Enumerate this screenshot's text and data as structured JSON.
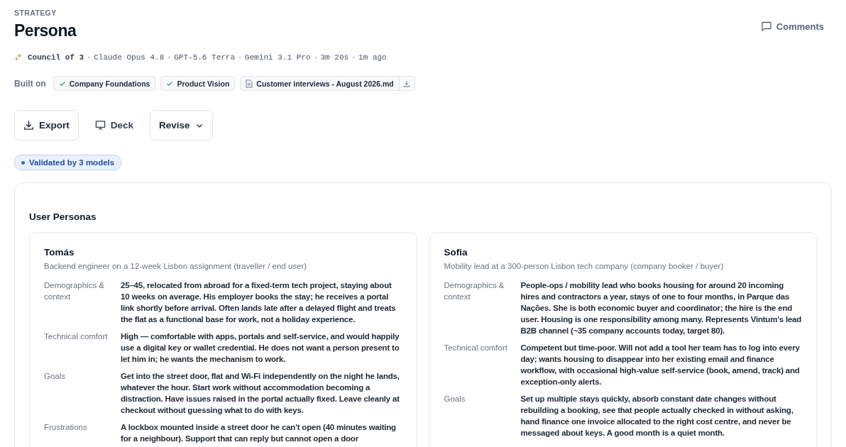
{
  "header": {
    "eyebrow": "STRATEGY",
    "title": "Persona",
    "comments": "Comments"
  },
  "meta": {
    "council": "Council of 3",
    "items": [
      "Claude Opus 4.8",
      "GPT-5.6 Terra",
      "Gemini 3.1 Pro",
      "3m 20s",
      "1m ago"
    ]
  },
  "built_on": {
    "label": "Built on",
    "sources": [
      {
        "kind": "check",
        "label": "Company Foundations"
      },
      {
        "kind": "check",
        "label": "Product Vision"
      },
      {
        "kind": "file",
        "label": "Customer interviews - August 2026.md"
      }
    ]
  },
  "actions": [
    {
      "kind": "download",
      "label": "Export"
    },
    {
      "kind": "deck",
      "label": "Deck"
    },
    {
      "kind": "dropdown",
      "label": "Revise"
    }
  ],
  "validation": "Validated by 3 models",
  "section": {
    "title": "User Personas",
    "personas": [
      {
        "name": "Tomás",
        "role": "Backend engineer on a 12-week Lisbon assignment (traveller / end user)",
        "fields": [
          {
            "label": "Demographics & context",
            "value": "25–45, relocated from abroad for a fixed-term tech project, staying about 10 weeks on average. His employer books the stay; he receives a portal link shortly before arrival. Often lands late after a delayed flight and treats the flat as a functional base for work, not a holiday experience."
          },
          {
            "label": "Technical comfort",
            "value": "High — comfortable with apps, portals and self-service, and would happily use a digital key or wallet credential. He does not want a person present to let him in; he wants the mechanism to work."
          },
          {
            "label": "Goals",
            "value": "Get into the street door, flat and Wi-Fi independently on the night he lands, whatever the hour. Start work without accommodation becoming a distraction. Have issues raised in the portal actually fixed. Leave cleanly at checkout without guessing what to do with keys."
          },
          {
            "label": "Frustrations",
            "value": "A lockbox mounted inside a street door he can't open (40 minutes waiting for a neighbour). Support that can reply but cannot open a door"
          }
        ]
      },
      {
        "name": "Sofia",
        "role": "Mobility lead at a 300-person Lisbon tech company (company booker / buyer)",
        "fields": [
          {
            "label": "Demographics & context",
            "value": "People-ops / mobility lead who books housing for around 20 incoming hires and contractors a year, stays of one to four months, in Parque das Nações. She is both economic buyer and coordinator; the hire is the end user. Housing is one responsibility among many. Represents Vintum's lead B2B channel (~35 company accounts today, target 80)."
          },
          {
            "label": "Technical comfort",
            "value": "Competent but time-poor. Will not add a tool her team has to log into every day; wants housing to disappear into her existing email and finance workflow, with occasional high-value self-service (book, amend, track) and exception-only alerts."
          },
          {
            "label": "Goals",
            "value": "Set up multiple stays quickly, absorb constant date changes without rebuilding a booking, see that people actually checked in without asking, hand finance one invoice allocated to the right cost centre, and never be messaged about keys. A good month is a quiet month."
          }
        ]
      }
    ]
  }
}
